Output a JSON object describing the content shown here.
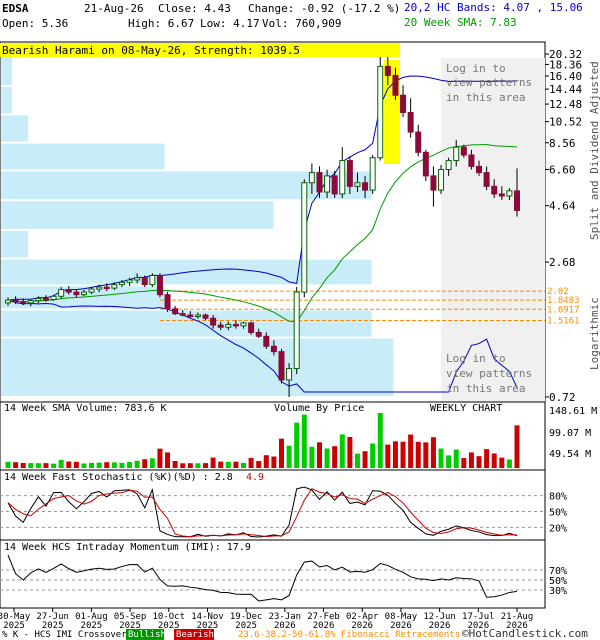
{
  "header": {
    "symbol": "EDSA",
    "date": "21-Aug-26",
    "close": "Close: 4.43",
    "change": "Change: -0.92 (-17.2 %)",
    "open": "Open: 5.36",
    "high": "High: 6.67",
    "low": "Low: 4.17",
    "vol": "Vol: 760,909",
    "bands": "20,2 HC Bands: 4.07 , 15.06",
    "sma": "20 Week SMA: 7.83"
  },
  "pattern_banner": "Bearish Harami on 08-May-26, Strength: 1039.5",
  "login_text_1": [
    "Log in to",
    "view patterns",
    "in this area"
  ],
  "login_text_2": [
    "Log in to",
    "view patterns",
    "in this area"
  ],
  "side_label_1": "Split and Dividend Adjusted",
  "side_label_2": "Logarithmic",
  "vol_label_left": "14 Week SMA Volume: 783.6 K",
  "vol_label_mid": "Volume By Price",
  "vol_label_right": "WEEKLY CHART",
  "stoch_label": "14 Week Fast Stochastic (%K)(%D) : 2.8",
  "stoch_label_d": "4.9",
  "imi_label": "14 Week HCS Intraday Momentum (IMI): 17.9",
  "footer": {
    "legend_prefix": "% K - HCS IMI Crossover:",
    "bullish": "Bullish",
    "bearish": "Bearish",
    "fib": "23.6-38.2-50-61.8% Fibonacci Retracements",
    "copyright": "©HotCandlestick.com"
  },
  "colors": {
    "up": "#006400",
    "down": "#8b0a3a",
    "bands": "#0000cc",
    "sma": "#009900",
    "vbp": "#c8ecf8",
    "fib": "#ff8c00",
    "highlight": "#ffff00",
    "stoch_k": "#000000",
    "stoch_d": "#cc0000",
    "shade": "#c8c8a0"
  },
  "chart_data": {
    "type": "candlestick",
    "scale": "log",
    "ylim": [
      0.72,
      20.32
    ],
    "price_ticks": [
      "20.32",
      "18.36",
      "16.40",
      "14.44",
      "12.48",
      "10.52",
      "8.56",
      "6.60",
      "4.64",
      "2.68",
      "0.72"
    ],
    "fib_levels": [
      "2.02",
      "1.8483",
      "1.6917",
      "1.5161"
    ],
    "volume_ticks": [
      "148.61 M",
      "99.07 M",
      "49.54 M"
    ],
    "stoch_ticks": [
      "80%",
      "50%",
      "20%"
    ],
    "imi_ticks": [
      "70%",
      "50%",
      "30%"
    ],
    "x_labels": [
      [
        "30-May",
        "2025"
      ],
      [
        "27-Jun",
        "2025"
      ],
      [
        "01-Aug",
        "2025"
      ],
      [
        "05-Sep",
        "2025"
      ],
      [
        "10-Oct",
        "2025"
      ],
      [
        "14-Nov",
        "2025"
      ],
      [
        "19-Dec",
        "2025"
      ],
      [
        "23-Jan",
        "2026"
      ],
      [
        "27-Feb",
        "2026"
      ],
      [
        "02-Apr",
        "2026"
      ],
      [
        "08-May",
        "2026"
      ],
      [
        "12-Jun",
        "2026"
      ],
      [
        "17-Jul",
        "2026"
      ],
      [
        "21-Aug",
        "2026"
      ]
    ],
    "candles": [
      [
        1.8,
        1.9,
        1.75,
        1.85
      ],
      [
        1.85,
        1.92,
        1.78,
        1.82
      ],
      [
        1.82,
        1.88,
        1.76,
        1.8
      ],
      [
        1.8,
        1.86,
        1.74,
        1.84
      ],
      [
        1.84,
        1.92,
        1.8,
        1.88
      ],
      [
        1.88,
        1.94,
        1.82,
        1.86
      ],
      [
        1.86,
        1.95,
        1.84,
        1.92
      ],
      [
        1.92,
        2.1,
        1.88,
        2.05
      ],
      [
        2.05,
        2.12,
        1.95,
        2.0
      ],
      [
        2.0,
        2.06,
        1.9,
        1.95
      ],
      [
        1.95,
        2.04,
        1.92,
        2.0
      ],
      [
        2.0,
        2.1,
        1.96,
        2.06
      ],
      [
        2.06,
        2.15,
        2.0,
        2.1
      ],
      [
        2.1,
        2.18,
        2.02,
        2.08
      ],
      [
        2.08,
        2.2,
        2.04,
        2.15
      ],
      [
        2.15,
        2.25,
        2.1,
        2.2
      ],
      [
        2.2,
        2.3,
        2.12,
        2.25
      ],
      [
        2.25,
        2.4,
        2.18,
        2.3
      ],
      [
        2.3,
        2.35,
        2.1,
        2.15
      ],
      [
        2.15,
        2.4,
        2.1,
        2.35
      ],
      [
        2.35,
        2.4,
        1.9,
        1.95
      ],
      [
        1.95,
        2.0,
        1.65,
        1.7
      ],
      [
        1.7,
        1.75,
        1.6,
        1.62
      ],
      [
        1.62,
        1.68,
        1.58,
        1.6
      ],
      [
        1.6,
        1.66,
        1.56,
        1.58
      ],
      [
        1.58,
        1.64,
        1.54,
        1.6
      ],
      [
        1.6,
        1.62,
        1.52,
        1.55
      ],
      [
        1.55,
        1.6,
        1.4,
        1.45
      ],
      [
        1.45,
        1.5,
        1.38,
        1.42
      ],
      [
        1.42,
        1.5,
        1.38,
        1.46
      ],
      [
        1.46,
        1.52,
        1.4,
        1.44
      ],
      [
        1.44,
        1.5,
        1.4,
        1.48
      ],
      [
        1.48,
        1.5,
        1.32,
        1.35
      ],
      [
        1.35,
        1.4,
        1.28,
        1.3
      ],
      [
        1.3,
        1.35,
        1.15,
        1.18
      ],
      [
        1.18,
        1.25,
        1.08,
        1.12
      ],
      [
        1.12,
        1.15,
        0.82,
        0.85
      ],
      [
        0.85,
        1.0,
        0.72,
        0.95
      ],
      [
        0.95,
        2.1,
        0.9,
        2.0
      ],
      [
        2.0,
        6.0,
        1.9,
        5.8
      ],
      [
        5.8,
        7.0,
        5.2,
        6.4
      ],
      [
        6.4,
        6.8,
        5.0,
        5.3
      ],
      [
        5.3,
        6.6,
        5.0,
        6.2
      ],
      [
        6.2,
        6.5,
        5.0,
        5.2
      ],
      [
        5.2,
        8.2,
        5.0,
        7.2
      ],
      [
        7.2,
        7.5,
        5.2,
        5.6
      ],
      [
        5.6,
        6.4,
        5.3,
        5.8
      ],
      [
        5.8,
        6.2,
        5.0,
        5.4
      ],
      [
        5.4,
        7.6,
        5.2,
        7.4
      ],
      [
        7.4,
        20.3,
        7.2,
        18.0
      ],
      [
        18.0,
        20.1,
        15.0,
        16.5
      ],
      [
        16.5,
        17.8,
        13.0,
        13.6
      ],
      [
        13.6,
        15.0,
        11.0,
        11.5
      ],
      [
        11.5,
        13.2,
        9.0,
        9.5
      ],
      [
        9.5,
        10.2,
        7.5,
        7.8
      ],
      [
        7.8,
        8.0,
        5.9,
        6.2
      ],
      [
        6.2,
        6.8,
        4.6,
        5.4
      ],
      [
        5.4,
        6.9,
        5.2,
        6.6
      ],
      [
        6.6,
        7.4,
        6.2,
        7.2
      ],
      [
        7.2,
        8.8,
        6.8,
        8.2
      ],
      [
        8.2,
        8.4,
        7.4,
        7.6
      ],
      [
        7.6,
        8.0,
        6.6,
        6.8
      ],
      [
        6.8,
        7.2,
        6.2,
        6.4
      ],
      [
        6.4,
        6.8,
        5.4,
        5.6
      ],
      [
        5.6,
        6.0,
        5.0,
        5.2
      ],
      [
        5.2,
        5.6,
        4.9,
        5.1
      ],
      [
        5.1,
        5.5,
        4.9,
        5.36
      ],
      [
        5.36,
        6.67,
        4.17,
        4.43
      ]
    ],
    "volume_profile": [
      {
        "level": 1.1,
        "width": 0.72
      },
      {
        "level": 1.5,
        "width": 0.68
      },
      {
        "level": 1.9,
        "width": 0.3
      },
      {
        "level": 2.4,
        "width": 0.68
      },
      {
        "level": 3.2,
        "width": 0.05
      },
      {
        "level": 4.2,
        "width": 0.5
      },
      {
        "level": 5.7,
        "width": 0.68
      },
      {
        "level": 7.5,
        "width": 0.3
      },
      {
        "level": 9.8,
        "width": 0.05
      },
      {
        "level": 13.0,
        "width": 0.02
      },
      {
        "level": 17.0,
        "width": 0.02
      }
    ]
  }
}
